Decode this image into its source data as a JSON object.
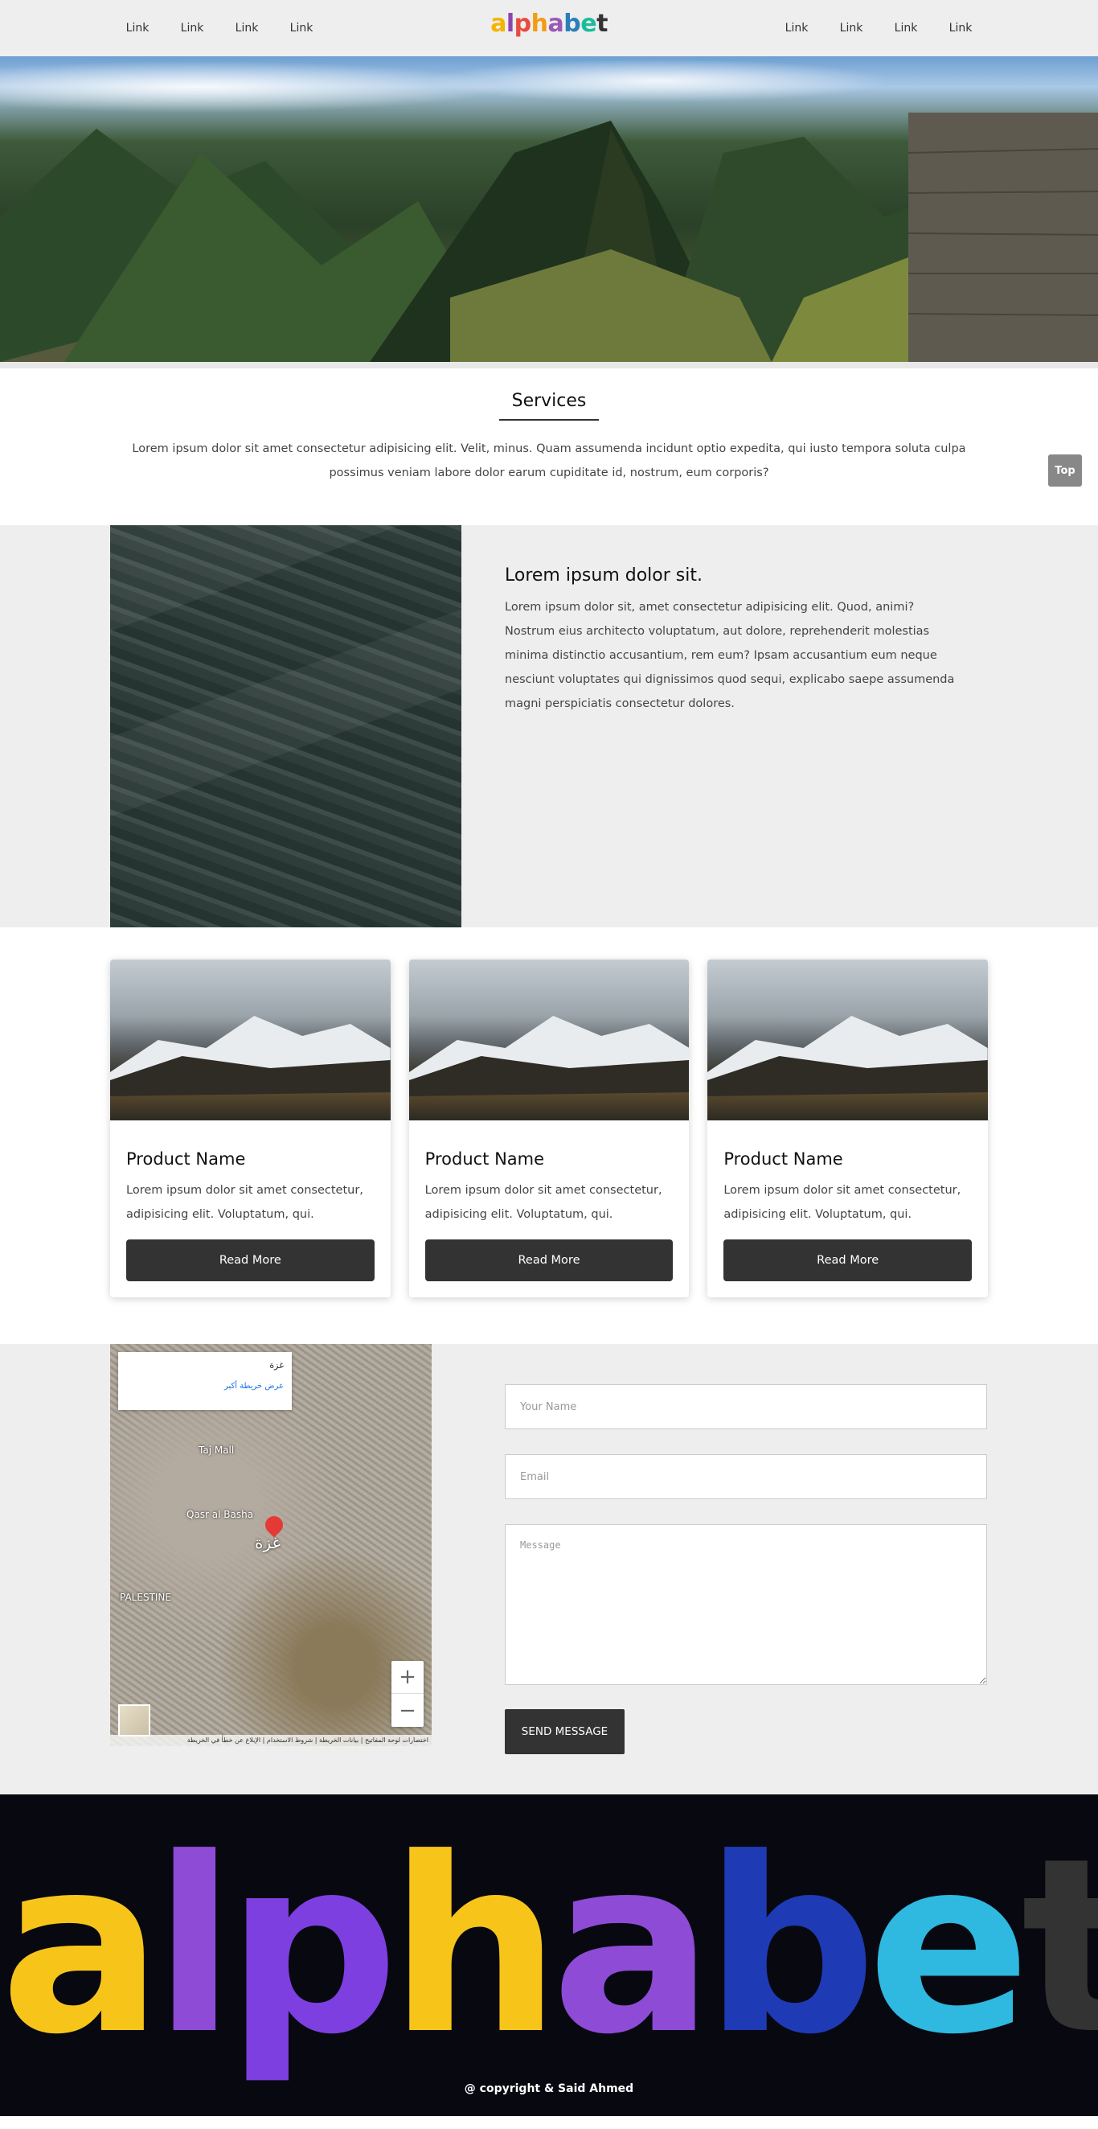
{
  "nav": {
    "left_links": [
      "Link",
      "Link",
      "Link",
      "Link"
    ],
    "right_links": [
      "Link",
      "Link",
      "Link",
      "Link"
    ],
    "logo": [
      "a",
      "l",
      "p",
      "h",
      "a",
      "b",
      "e",
      "t"
    ]
  },
  "services": {
    "title": "Services",
    "text": "Lorem ipsum dolor sit amet consectetur adipisicing elit. Velit, minus. Quam assumenda incidunt optio expedita, qui iusto tempora soluta culpa possimus veniam labore dolor earum cupiditate id, nostrum, eum corporis?"
  },
  "top_button": "Top",
  "about": {
    "title": "Lorem ipsum dolor sit.",
    "text": "Lorem ipsum dolor sit, amet consectetur adipisicing elit. Quod, animi? Nostrum eius architecto voluptatum, aut dolore, reprehenderit molestias minima distinctio accusantium, rem eum? Ipsam accusantium eum neque nesciunt voluptates qui dignissimos quod sequi, explicabo saepe assumenda magni perspiciatis consectetur dolores."
  },
  "products": [
    {
      "name": "Product Name",
      "text": "Lorem ipsum dolor sit amet consectetur, adipisicing elit. Voluptatum, qui.",
      "button": "Read More"
    },
    {
      "name": "Product Name",
      "text": "Lorem ipsum dolor sit amet consectetur, adipisicing elit. Voluptatum, qui.",
      "button": "Read More"
    },
    {
      "name": "Product Name",
      "text": "Lorem ipsum dolor sit amet consectetur, adipisicing elit. Voluptatum, qui.",
      "button": "Read More"
    }
  ],
  "map": {
    "place": "غزة",
    "larger_map": "عرض خريطة أكبر",
    "labels": [
      "Taj Mall",
      "Qasr al Basha",
      "غزة",
      "PALESTINE"
    ],
    "zoom_in": "+",
    "zoom_out": "−",
    "footer": "اختصارات لوحة المفاتيح | بيانات الخريطة | شروط الاستخدام | الإبلاغ عن خطأ في الخريطة"
  },
  "contact": {
    "name_placeholder": "Your Name",
    "email_placeholder": "Email",
    "message_placeholder": "Message",
    "send": "SEND MESSAGE"
  },
  "footer": {
    "logo": [
      "a",
      "l",
      "p",
      "h",
      "a",
      "b",
      "e",
      "t"
    ],
    "copyright": "@ copyright & Said Ahmed"
  }
}
